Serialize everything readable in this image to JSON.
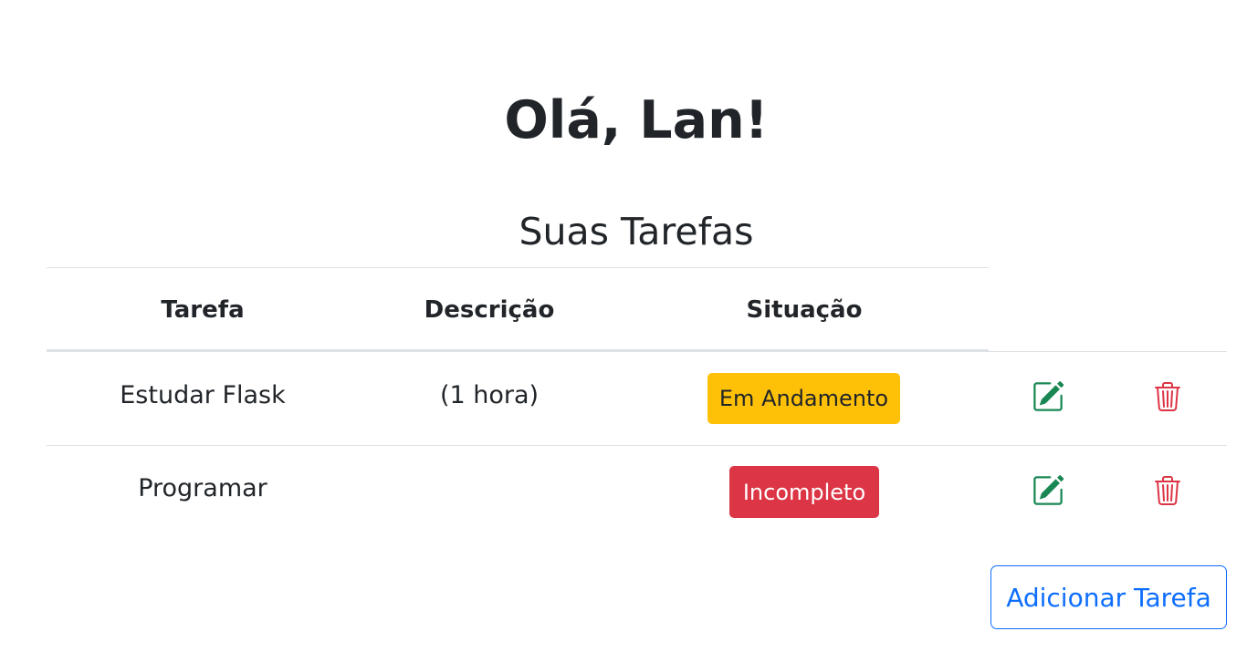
{
  "header": {
    "greeting": "Olá, Lan!",
    "subtitle": "Suas Tarefas"
  },
  "table": {
    "columns": [
      "Tarefa",
      "Descrição",
      "Situação"
    ],
    "rows": [
      {
        "tarefa": "Estudar Flask",
        "descricao": "(1 hora)",
        "situacao": "Em Andamento",
        "status_color": "#ffc107"
      },
      {
        "tarefa": "Programar",
        "descricao": "",
        "situacao": "Incompleto",
        "status_color": "#dc3545"
      }
    ],
    "row_actions": {
      "edit_icon": "pencil-square-icon",
      "delete_icon": "trash-icon"
    }
  },
  "actions": {
    "add_task_label": "Adicionar Tarefa"
  },
  "colors": {
    "primary": "#0d6efd",
    "edit": "#198754",
    "delete": "#dc3545"
  }
}
